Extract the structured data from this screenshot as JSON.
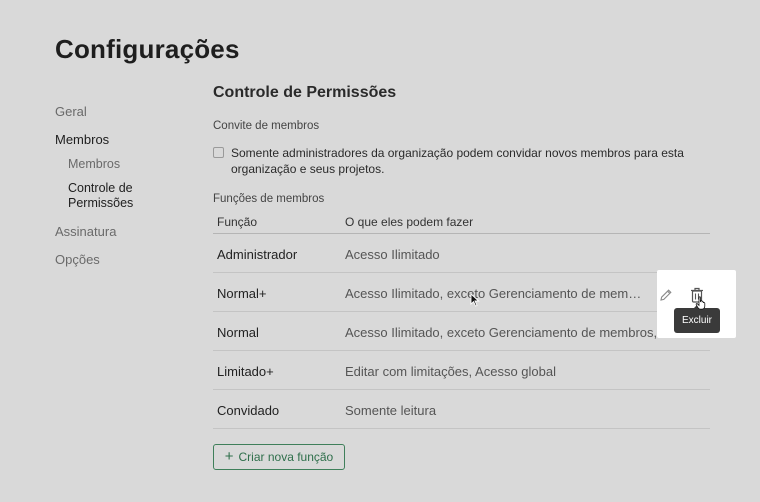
{
  "page": {
    "title": "Configurações"
  },
  "sidebar": {
    "items": [
      {
        "label": "Geral"
      },
      {
        "label": "Membros"
      },
      {
        "label": "Assinatura"
      },
      {
        "label": "Opções"
      }
    ],
    "sub_items": [
      {
        "label": "Membros"
      },
      {
        "label": "Controle de Permissões"
      }
    ]
  },
  "main": {
    "section_title": "Controle de Permissões",
    "invite_label": "Convite de membros",
    "invite_checkbox_text": "Somente administradores da organização podem convidar novos membros para esta organização e seus projetos.",
    "invite_checked": false,
    "roles_label": "Funções de membros",
    "table": {
      "headers": [
        "Função",
        "O que eles podem fazer"
      ],
      "rows": [
        {
          "role": "Administrador",
          "permissions": "Acesso Ilimitado"
        },
        {
          "role": "Normal+",
          "permissions": "Acesso Ilimitado, exceto Gerenciamento de membros"
        },
        {
          "role": "Normal",
          "permissions": "Acesso Ilimitado, exceto Gerenciamento de membros, Excluir"
        },
        {
          "role": "Limitado+",
          "permissions": "Editar com limitações, Acesso global"
        },
        {
          "role": "Convidado",
          "permissions": "Somente leitura"
        }
      ]
    },
    "tooltip": "Excluir",
    "create_button": "Criar nova função",
    "create_button_icon": "+"
  },
  "colors": {
    "background": "#d9d9d9",
    "accent_green": "#2f6f4b",
    "tooltip_bg": "#3a3a3a"
  },
  "icons": [
    "pencil-icon",
    "trash-icon",
    "plus-icon",
    "mouse-cursor-icon",
    "hand-cursor-icon"
  ]
}
